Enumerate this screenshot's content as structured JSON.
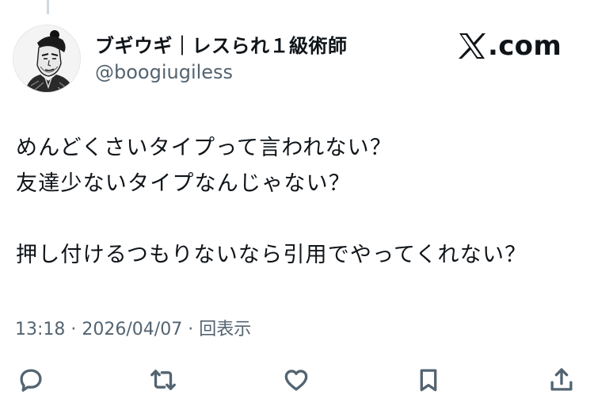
{
  "author": {
    "display_name": "ブギウギ｜レスられ１級術師",
    "handle": "@boogiugiless"
  },
  "brand": {
    "label": ".com"
  },
  "tweet": {
    "lines": [
      "めんどくさいタイプって言われない？",
      "友達少ないタイプなんじゃない？",
      "",
      "押し付けるつもりないなら引用でやってくれない？"
    ]
  },
  "meta": {
    "time": "13:18",
    "separator": " · ",
    "date": "2026/04/07",
    "views": "回表示"
  },
  "actions": [
    {
      "name": "reply",
      "icon": "reply-icon"
    },
    {
      "name": "retweet",
      "icon": "retweet-icon"
    },
    {
      "name": "like",
      "icon": "heart-icon"
    },
    {
      "name": "bookmark",
      "icon": "bookmark-icon"
    },
    {
      "name": "share",
      "icon": "share-icon"
    }
  ],
  "colors": {
    "text_primary": "#0f1419",
    "text_secondary": "#536471",
    "background": "#ffffff"
  }
}
